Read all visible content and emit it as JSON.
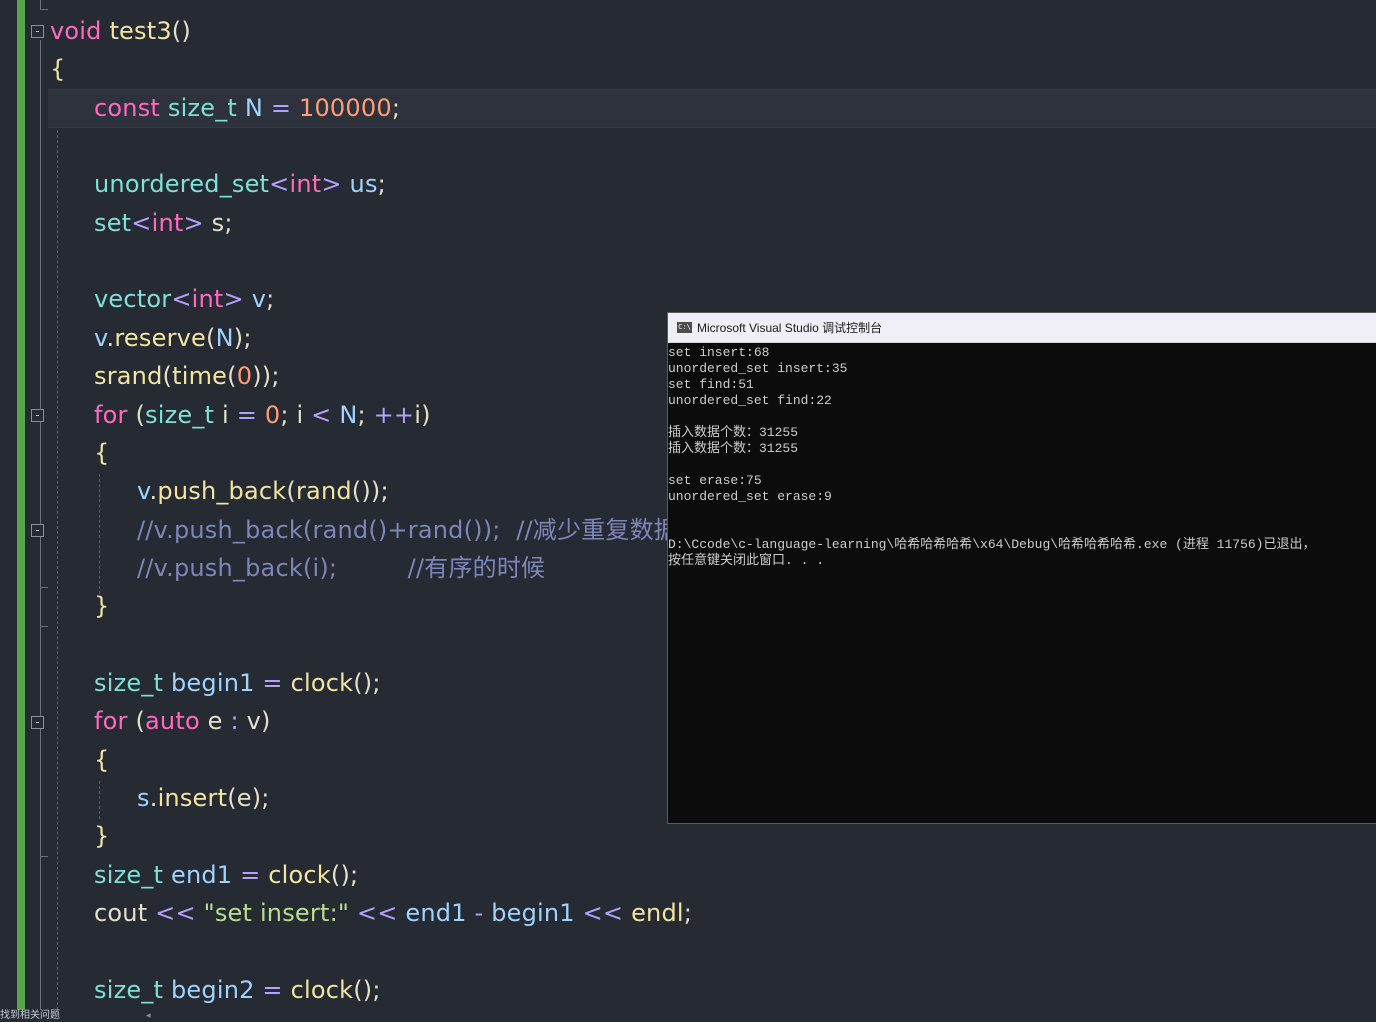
{
  "editor": {
    "lines": [
      {
        "segments": [
          {
            "t": "void",
            "c": "kw"
          },
          {
            "t": " ",
            "c": "pl"
          },
          {
            "t": "test3",
            "c": "fn"
          },
          {
            "t": "()",
            "c": "pl"
          }
        ]
      },
      {
        "segments": [
          {
            "t": "{",
            "c": "fn"
          }
        ]
      },
      {
        "segments": [
          {
            "t": "const",
            "c": "kw"
          },
          {
            "t": " ",
            "c": "pl"
          },
          {
            "t": "size_t",
            "c": "ty"
          },
          {
            "t": " ",
            "c": "pl"
          },
          {
            "t": "N",
            "c": "id"
          },
          {
            "t": " = ",
            "c": "op"
          },
          {
            "t": "100000",
            "c": "num"
          },
          {
            "t": ";",
            "c": "pl"
          }
        ]
      },
      {
        "segments": []
      },
      {
        "segments": [
          {
            "t": "unordered_set",
            "c": "ty"
          },
          {
            "t": "<",
            "c": "op"
          },
          {
            "t": "int",
            "c": "kw"
          },
          {
            "t": ">",
            "c": "op"
          },
          {
            "t": " ",
            "c": "pl"
          },
          {
            "t": "us",
            "c": "id"
          },
          {
            "t": ";",
            "c": "pl"
          }
        ]
      },
      {
        "segments": [
          {
            "t": "set",
            "c": "ty"
          },
          {
            "t": "<",
            "c": "op"
          },
          {
            "t": "int",
            "c": "kw"
          },
          {
            "t": ">",
            "c": "op"
          },
          {
            "t": " s;",
            "c": "pl"
          }
        ]
      },
      {
        "segments": []
      },
      {
        "segments": [
          {
            "t": "vector",
            "c": "ty"
          },
          {
            "t": "<",
            "c": "op"
          },
          {
            "t": "int",
            "c": "kw"
          },
          {
            "t": ">",
            "c": "op"
          },
          {
            "t": " ",
            "c": "pl"
          },
          {
            "t": "v",
            "c": "id"
          },
          {
            "t": ";",
            "c": "pl"
          }
        ]
      },
      {
        "segments": [
          {
            "t": "v",
            "c": "id"
          },
          {
            "t": ".",
            "c": "pl"
          },
          {
            "t": "reserve",
            "c": "fn"
          },
          {
            "t": "(",
            "c": "pl"
          },
          {
            "t": "N",
            "c": "id"
          },
          {
            "t": ");",
            "c": "pl"
          }
        ]
      },
      {
        "segments": [
          {
            "t": "srand",
            "c": "fn"
          },
          {
            "t": "(",
            "c": "pl"
          },
          {
            "t": "time",
            "c": "fn"
          },
          {
            "t": "(",
            "c": "pl"
          },
          {
            "t": "0",
            "c": "num"
          },
          {
            "t": "));",
            "c": "pl"
          }
        ]
      },
      {
        "segments": [
          {
            "t": "for",
            "c": "kw"
          },
          {
            "t": " (",
            "c": "pl"
          },
          {
            "t": "size_t",
            "c": "ty"
          },
          {
            "t": " i ",
            "c": "pl"
          },
          {
            "t": "=",
            "c": "op"
          },
          {
            "t": " ",
            "c": "pl"
          },
          {
            "t": "0",
            "c": "num"
          },
          {
            "t": "; i ",
            "c": "pl"
          },
          {
            "t": "<",
            "c": "op"
          },
          {
            "t": " ",
            "c": "pl"
          },
          {
            "t": "N",
            "c": "id"
          },
          {
            "t": "; ",
            "c": "pl"
          },
          {
            "t": "++",
            "c": "op"
          },
          {
            "t": "i)",
            "c": "pl"
          }
        ]
      },
      {
        "segments": [
          {
            "t": "{",
            "c": "fn"
          }
        ]
      },
      {
        "segments": [
          {
            "t": "v",
            "c": "id"
          },
          {
            "t": ".",
            "c": "pl"
          },
          {
            "t": "push_back",
            "c": "fn"
          },
          {
            "t": "(",
            "c": "pl"
          },
          {
            "t": "rand",
            "c": "fn"
          },
          {
            "t": "());",
            "c": "pl"
          }
        ]
      },
      {
        "segments": [
          {
            "t": "//v.push_back(rand()+rand());  //减少重复数据",
            "c": "cm"
          }
        ]
      },
      {
        "segments": [
          {
            "t": "//v.push_back(i);         //有序的时候",
            "c": "cm"
          }
        ]
      },
      {
        "segments": [
          {
            "t": "}",
            "c": "fn"
          }
        ]
      },
      {
        "segments": []
      },
      {
        "segments": [
          {
            "t": "size_t",
            "c": "ty"
          },
          {
            "t": " ",
            "c": "pl"
          },
          {
            "t": "begin1",
            "c": "id"
          },
          {
            "t": " = ",
            "c": "op"
          },
          {
            "t": "clock",
            "c": "fn"
          },
          {
            "t": "();",
            "c": "pl"
          }
        ]
      },
      {
        "segments": [
          {
            "t": "for",
            "c": "kw"
          },
          {
            "t": " (",
            "c": "pl"
          },
          {
            "t": "auto",
            "c": "kw"
          },
          {
            "t": " e ",
            "c": "pl"
          },
          {
            "t": ":",
            "c": "op"
          },
          {
            "t": " v)",
            "c": "pl"
          }
        ]
      },
      {
        "segments": [
          {
            "t": "{",
            "c": "fn"
          }
        ]
      },
      {
        "segments": [
          {
            "t": "s",
            "c": "id"
          },
          {
            "t": ".",
            "c": "pl"
          },
          {
            "t": "insert",
            "c": "fn"
          },
          {
            "t": "(e);",
            "c": "pl"
          }
        ]
      },
      {
        "segments": [
          {
            "t": "}",
            "c": "fn"
          }
        ]
      },
      {
        "segments": [
          {
            "t": "size_t",
            "c": "ty"
          },
          {
            "t": " ",
            "c": "pl"
          },
          {
            "t": "end1",
            "c": "id"
          },
          {
            "t": " = ",
            "c": "op"
          },
          {
            "t": "clock",
            "c": "fn"
          },
          {
            "t": "();",
            "c": "pl"
          }
        ]
      },
      {
        "segments": [
          {
            "t": "cout",
            "c": "pl"
          },
          {
            "t": " << ",
            "c": "op"
          },
          {
            "t": "\"set insert:\"",
            "c": "str"
          },
          {
            "t": " << ",
            "c": "op"
          },
          {
            "t": "end1",
            "c": "id"
          },
          {
            "t": " - ",
            "c": "op"
          },
          {
            "t": "begin1",
            "c": "id"
          },
          {
            "t": " << ",
            "c": "op"
          },
          {
            "t": "endl",
            "c": "fn"
          },
          {
            "t": ";",
            "c": "pl"
          }
        ]
      },
      {
        "segments": []
      },
      {
        "segments": [
          {
            "t": "size_t",
            "c": "ty"
          },
          {
            "t": " ",
            "c": "pl"
          },
          {
            "t": "begin2",
            "c": "id"
          },
          {
            "t": " = ",
            "c": "op"
          },
          {
            "t": "clock",
            "c": "fn"
          },
          {
            "t": "();",
            "c": "pl"
          }
        ]
      }
    ],
    "fold_markers": [
      "-",
      "-",
      "-",
      "-"
    ]
  },
  "status": {
    "text": "找到相关问题",
    "arrow": "◂"
  },
  "console": {
    "icon_text": "C:\\",
    "title": "Microsoft Visual Studio 调试控制台",
    "lines": [
      "set insert:68",
      "unordered_set insert:35",
      "set find:51",
      "unordered_set find:22",
      "",
      "插入数据个数：31255",
      "插入数据个数：31255",
      "",
      "set erase:75",
      "unordered_set erase:9",
      "",
      "",
      "D:\\Ccode\\c-language-learning\\哈希哈希哈希\\x64\\Debug\\哈希哈希哈希.exe (进程 11756)已退出，",
      "按任意键关闭此窗口. . ."
    ]
  },
  "colors": {
    "editor_bg": "#262a33",
    "change_bar": "#57a64a",
    "keyword": "#ff6ac1",
    "type": "#7fe0d6",
    "function": "#f2e5a2",
    "number": "#ff9d73",
    "comment": "#7d86b8",
    "console_bg": "#0c0c0c"
  }
}
